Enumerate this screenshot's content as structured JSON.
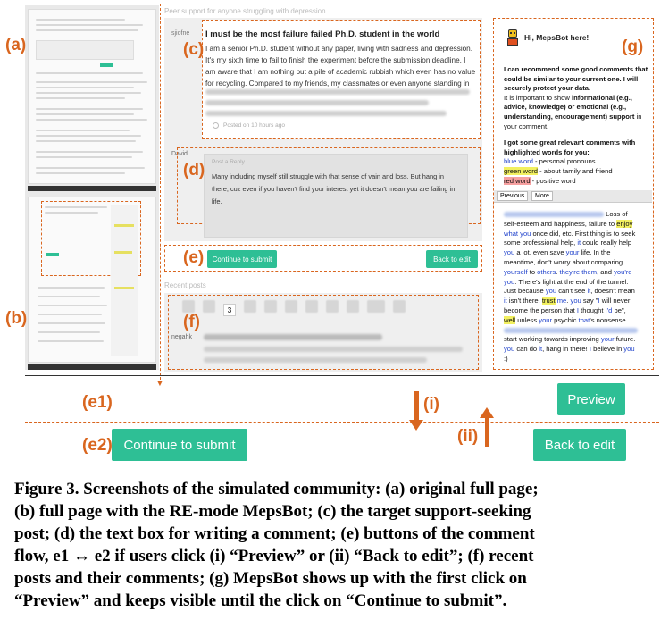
{
  "header_strip": "Peer support for anyone struggling with depression.",
  "labels": {
    "a": "(a)",
    "b": "(b)",
    "c": "(c)",
    "d": "(d)",
    "e": "(e)",
    "f": "(f)",
    "g": "(g)",
    "e1": "(e1)",
    "e2": "(e2)",
    "i": "(i)",
    "ii": "(ii)"
  },
  "post": {
    "author": "sjiofne",
    "title": "I must be the most failure failed Ph.D. student in the world",
    "body": "I am a senior Ph.D. student without any paper, living with sadness and depression. It's my sixth time to fail to finish the experiment before the submission deadline. I am aware that I am nothing but a pile of academic rubbish which even has no value for recycling. Compared to my friends, my classmates or even anyone standing in the hall of",
    "posted": "Posted on 10 hours ago"
  },
  "reply": {
    "author": "David",
    "placeholder": "Post a Reply",
    "text": "Many including myself still struggle with that sense of vain and loss. But hang in there, cuz even if you haven't find your interest yet it doesn't mean you are failing in life."
  },
  "buttons": {
    "continue": "Continue to submit",
    "back": "Back to edit",
    "preview": "Preview"
  },
  "recent": {
    "title": "Recent posts",
    "current_page": "3",
    "author": "negahk"
  },
  "bot": {
    "greeting": "Hi, MepsBot here!",
    "intro_bold": "I can recommend some good comments that could be similar to your current one. I will securely protect your data.",
    "important_pre": "It is important to show ",
    "informational": "informational",
    "important_mid1": " (e.g., advice, knowledge) or ",
    "emotional": "emotional",
    "important_mid2": " (e.g., understanding, encouragement) ",
    "support": "support",
    "important_post": " in your comment.",
    "highlight_intro": "I got some great relevant comments with highlighted words for you:",
    "blue_word": "blue word",
    "blue_desc": " - personal pronouns",
    "green_word": "green word",
    "green_desc": " - about family and friend",
    "red_word": "red word",
    "red_desc": " - positive word",
    "tab_previous": "Previous",
    "tab_more": "More",
    "c1": "Loss of",
    "c2": "self-esteem and happiness, failure to ",
    "c2_hl": "enjoy",
    "c3_a": "what ",
    "c3_b": "you",
    "c3_c": " once did, etc. First thing is to seek",
    "c4": "some professional help, ",
    "c4_it": "it",
    "c4_b": " could really help",
    "c5_a": "you",
    "c5_b": " a lot, even save ",
    "c5_c": "your",
    "c5_d": " life. In the",
    "c6": "meantime, don't worry about comparing",
    "c7_a": "yourself",
    "c7_b": " to ",
    "c7_c": "others",
    "c7_d": ". ",
    "c7_e": "they're",
    "c7_f": " ",
    "c7_g": "them",
    "c7_h": ", and ",
    "c7_i": "you're",
    "c8_a": "you",
    "c8_b": ". There's light at the end of the tunnel.",
    "c9_a": "Just because ",
    "c9_b": "you",
    "c9_c": " can't see ",
    "c9_d": "it",
    "c9_e": ", doesn't mean",
    "c10_a": "it",
    "c10_b": " isn't there. ",
    "c10_c": "trust",
    "c10_d": " ",
    "c10_e": "me",
    "c10_f": ". ",
    "c10_g": "you",
    "c10_h": " say \"",
    "c10_i": "I",
    "c10_j": " will never",
    "c11_a": "become the person that ",
    "c11_b": "I",
    "c11_c": " thought ",
    "c11_d": "I'd",
    "c11_e": " be\",",
    "c12_a": "well",
    "c12_b": " unless ",
    "c12_c": "your",
    "c12_d": " psychic ",
    "c12_e": "that",
    "c12_f": "'s nonsense.",
    "c13_a": "start working towards improving ",
    "c13_b": "your",
    "c13_c": " future.",
    "c14_a": "you",
    "c14_b": " can do ",
    "c14_c": "it",
    "c14_d": ", hang in there! ",
    "c14_e": "I",
    "c14_f": " believe in ",
    "c14_g": "you",
    "c15": ":)"
  },
  "caption": {
    "line1": "Figure 3. Screenshots of the simulated community: (a) original full page;",
    "line2": "(b) full page with the RE-mode MepsBot; (c) the target support-seeking",
    "line3": "post; (d) the text box for writing a comment; (e) buttons of the comment",
    "line4": "flow, e1 ↔ e2 if users click (i) “Preview” or (ii) “Back to edit”; (f) recent",
    "line5": "posts and their comments; (g) MepsBot shows up with the first click on",
    "line6": "“Preview” and keeps visible until the click on “Continue to submit”."
  },
  "colors": {
    "accent": "#d9661f",
    "button": "#2ebf95"
  }
}
